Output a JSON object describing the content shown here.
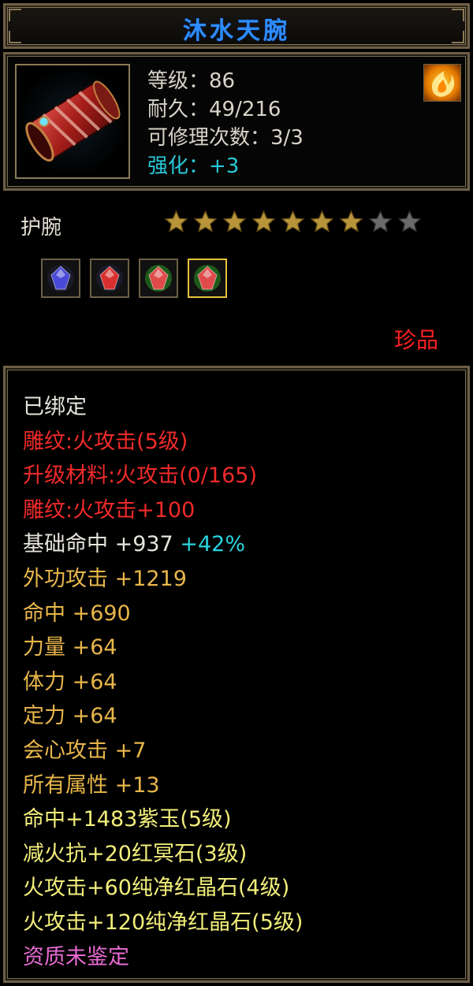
{
  "title": "沐水天腕",
  "colors": {
    "title": "#2e8cff",
    "white": "#e6e4dc",
    "red": "#f02a2a",
    "gold": "#e8b64a",
    "yellow": "#f2ee7a",
    "cyan": "#29d3de",
    "pink": "#e86bd4",
    "frame": "#6d5f45"
  },
  "item": {
    "icon": "red-bracer-icon",
    "element_icon": "fire-element-icon",
    "level": "等级：86",
    "durability": "耐久：49/216",
    "repairs": "可修理次数：3/3",
    "enhance": "强化：+3",
    "type": "护腕",
    "stars_total": 9,
    "stars_lit": 7,
    "rarity": "珍品"
  },
  "gems": [
    {
      "name": "purple-jade-gem-icon",
      "color": "#4a4ad8",
      "selected": false
    },
    {
      "name": "red-stone-gem-icon",
      "color": "#d83030",
      "selected": false
    },
    {
      "name": "red-crystal-gem-icon",
      "color": "#e04a4a",
      "selected": false
    },
    {
      "name": "red-crystal-gem-icon",
      "color": "#e04a4a",
      "selected": true
    }
  ],
  "attributes": {
    "bound": "已绑定",
    "engrave1": "雕纹:火攻击(5级)",
    "upgrade_material": "升级材料:火攻击(0/165)",
    "engrave2": "雕纹:火攻击+100",
    "base_hit": "基础命中 +937",
    "base_hit_bonus": "+42%",
    "outer_attack": "外功攻击 +1219",
    "hit": "命中 +690",
    "strength": "力量 +64",
    "constitution": "体力 +64",
    "focus": "定力 +64",
    "crit_attack": "会心攻击 +7",
    "all_attributes": "所有属性 +13",
    "gem1": "命中+1483紫玉(5级)",
    "gem2": "减火抗+20红冥石(3级)",
    "gem3": "火攻击+60纯净红晶石(4级)",
    "gem4": "火攻击+120纯净红晶石(5级)",
    "quality": "资质未鉴定"
  }
}
